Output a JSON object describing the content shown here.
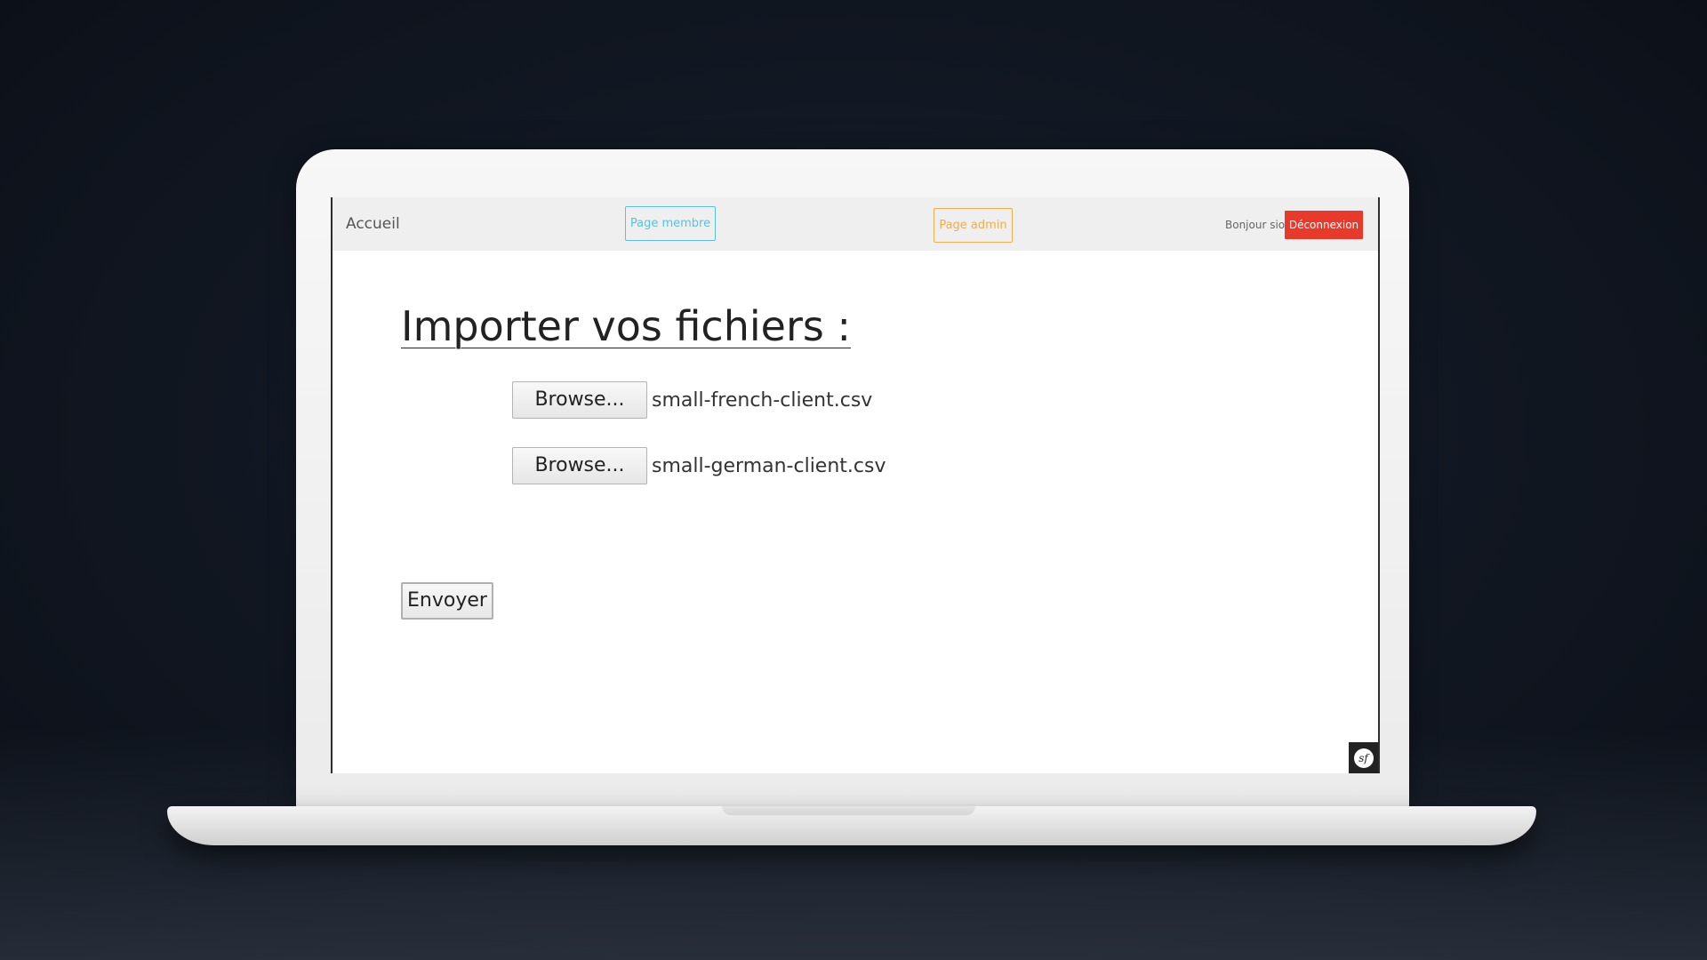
{
  "navbar": {
    "home_label": "Accueil",
    "member_label": "Page membre",
    "admin_label": "Page admin",
    "greeting": "Bonjour sio",
    "logout_label": "Déconnexion"
  },
  "main": {
    "title": "Importer vos fichiers :",
    "file_inputs": [
      {
        "button_label": "Browse...",
        "file_name": "small-french-client.csv"
      },
      {
        "button_label": "Browse...",
        "file_name": "small-german-client.csv"
      }
    ],
    "submit_label": "Envoyer"
  },
  "debug_toolbar": {
    "icon": "symfony-logo-icon",
    "logo_text": "sf"
  },
  "colors": {
    "member_accent": "#5bc0de",
    "admin_accent": "#f0ad4e",
    "logout_bg": "#e8392a",
    "navbar_bg": "#efefef"
  }
}
